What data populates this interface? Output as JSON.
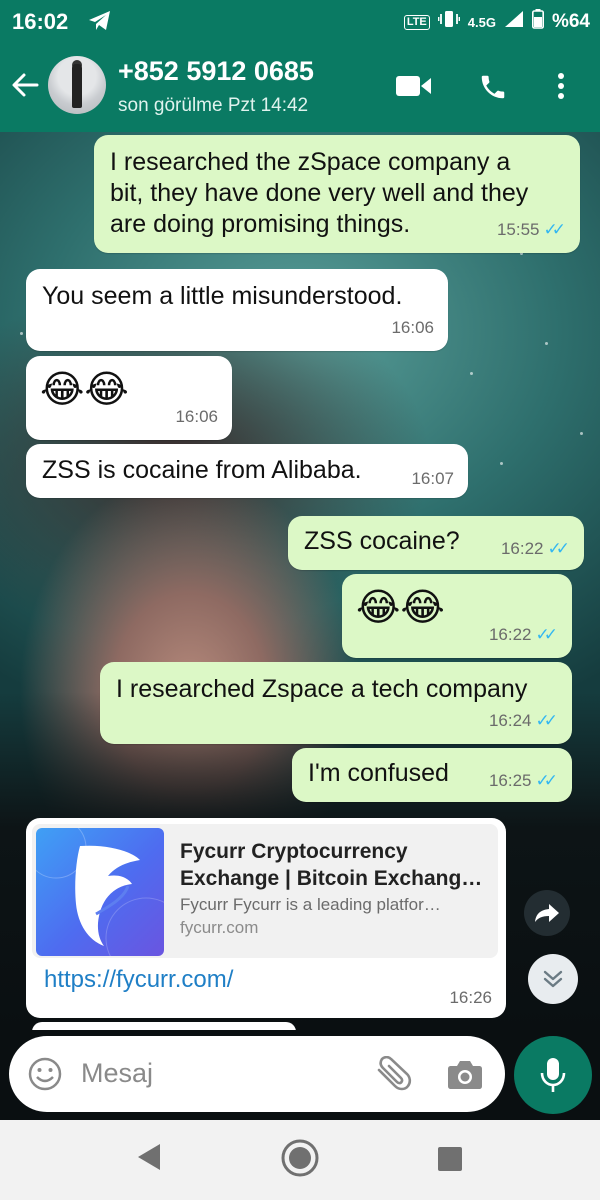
{
  "status_bar": {
    "time": "16:02",
    "network": "4.5G",
    "lte": "LTE",
    "battery": "%64"
  },
  "header": {
    "contact": "+852 5912 0685",
    "last_seen": "son görülme Pzt 14:42"
  },
  "messages": [
    {
      "dir": "out",
      "lines": [
        "I researched the zSpace company a",
        "bit, they have done very well and they",
        "are doing promising things."
      ],
      "time": "15:55"
    },
    {
      "dir": "in",
      "text": "You seem a little misunderstood.",
      "time": "16:06"
    },
    {
      "dir": "in",
      "text": "😂😂",
      "time": "16:06"
    },
    {
      "dir": "in",
      "text": "ZSS is cocaine from Alibaba.",
      "time": "16:07"
    },
    {
      "dir": "out",
      "text": "ZSS cocaine?",
      "time": "16:22"
    },
    {
      "dir": "out",
      "text": "😂😂",
      "time": "16:22"
    },
    {
      "dir": "out",
      "text": "I researched Zspace a tech company",
      "time": "16:24"
    },
    {
      "dir": "out",
      "text": "I'm confused",
      "time": "16:25"
    }
  ],
  "link_message": {
    "title_line1": "Fycurr Cryptocurrency",
    "title_line2": "Exchange | Bitcoin Exchang…",
    "description": "Fycurr Fycurr is a leading platfor…",
    "domain": "fycurr.com",
    "url": "https://fycurr.com/",
    "time": "16:26"
  },
  "input": {
    "placeholder": "Mesaj"
  },
  "colors": {
    "header": "#0a7a63",
    "outgoing_bubble": "#dcf8c6",
    "incoming_bubble": "#ffffff",
    "read_ticks": "#34b7f1",
    "link": "#1f7fc6"
  },
  "icons": [
    "telegram-icon",
    "back-arrow-icon",
    "video-call-icon",
    "phone-icon",
    "more-vert-icon",
    "forward-icon",
    "scroll-down-icon",
    "emoji-icon",
    "attach-icon",
    "camera-icon",
    "mic-icon",
    "nav-back-icon",
    "nav-home-icon",
    "nav-recents-icon"
  ]
}
